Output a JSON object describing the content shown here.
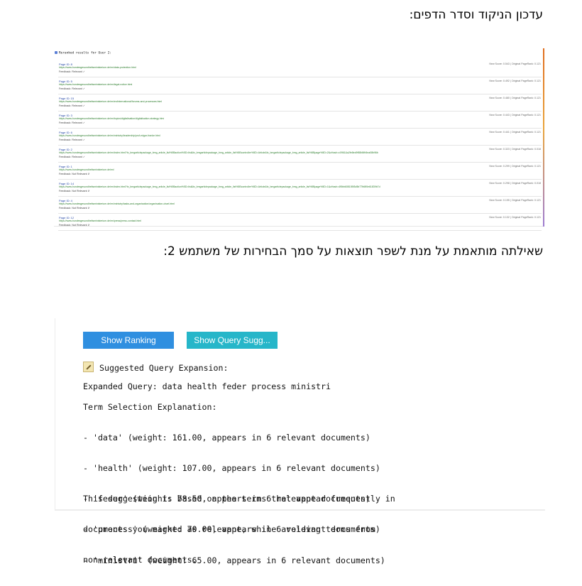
{
  "headings": {
    "top": "עדכון הניקוד וסדר הדפים:",
    "middle": "שאילתה מותאמת על מנת לשפר תוצאות על סמך הבחירות של משתמש 2:"
  },
  "rerank": {
    "title": "Reranked results for User 2:",
    "results": [
      {
        "page": "Page ID: 8",
        "url": "https://www.bundesgesundheitsministerium.de/en/data-protection.html",
        "feedback": "Feedback: Relevant ✓",
        "score": "New Score: 0.543 | Original PageRank: 0.121"
      },
      {
        "page": "Page ID: 5",
        "url": "https://www.bundesgesundheitsministerium.de/en/legal-notice.html",
        "feedback": "Feedback: Relevant ✓",
        "score": "New Score: 0.492 | Original PageRank: 0.121"
      },
      {
        "page": "Page ID: 15",
        "url": "https://www.bundesgesundheitsministerium.de/en/en/international/forums-and-processes.html",
        "feedback": "Feedback: Relevant ✓",
        "score": "New Score: 0.480 | Original PageRank: 0.121"
      },
      {
        "page": "Page ID: 3",
        "url": "https://www.bundesgesundheitsministerium.de/en/topics/digitalisation/digitalisation-strategy.html",
        "feedback": "Feedback: Relevant ✓",
        "score": "New Score: 0.443 | Original PageRank: 0.121"
      },
      {
        "page": "Page ID: 6",
        "url": "https://www.bundesgesundheitsministerium.de/en/ministry/leadership/prof-edgar-franke.html",
        "feedback": "Feedback: Relevant ✓",
        "score": "New Score: 0.441 | Original PageRank: 0.121"
      },
      {
        "page": "Page ID: 2",
        "url": "https://www.bundesgesundheitsministerium.de/en/index.html?tx_bmgarticlepackage_bmg_article_list%5Baction%5D=list&tx_bmgarticlepackage_bmg_article_list%5Bcontroller%5D=Article&tx_bmgarticlepackage_bmg_article_list%5Bpage%5D=2&cHash=c0961&a2fe8ed9f65b5fb5ea08b96b",
        "feedback": "Feedback: Relevant ✓",
        "score": "New Score: 0.323 | Original PageRank: 0.018"
      },
      {
        "page": "Page ID: 1",
        "url": "https://www.bundesgesundheitsministerium.de/en/",
        "feedback": "Feedback: Not Relevant ✗",
        "score": "New Score: 0.299 | Original PageRank: 0.121"
      },
      {
        "page": "Page ID: 14",
        "url": "https://www.bundesgesundheitsministerium.de/en/index.html?tx_bmgarticlepackage_bmg_article_list%5Baction%5D=list&tx_bmgarticlepackage_bmg_article_list%5Bcontroller%5D=Article&tx_bmgarticlepackage_bmg_article_list%5Bpage%5D=1&cHash=4f5bb608155f3d5b77fb8f0e61839b7d",
        "feedback": "Feedback: Not Relevant ✗",
        "score": "New Score: 0.298 | Original PageRank: 0.018"
      },
      {
        "page": "Page ID: 4",
        "url": "https://www.bundesgesundheitsministerium.de/en/ministry/tasks-and-organisation/organisation-chart.html",
        "feedback": "Feedback: Not Relevant ✗",
        "score": "New Score: 0.195 | Original PageRank: 0.121"
      },
      {
        "page": "Page ID: 12",
        "url": "https://www.bundesgesundheitsministerium.de/en/press/press-contact.html",
        "feedback": "Feedback: Not Relevant ✗",
        "score": "New Score: 0.132 | Original PageRank: 0.121"
      }
    ]
  },
  "buttons": {
    "show_ranking": "Show Ranking",
    "show_query": "Show Query Sugg..."
  },
  "suggestion": {
    "title": "Suggested Query Expansion:",
    "expanded": "Expanded Query: data health feder process ministri",
    "explanation_title": "Term Selection Explanation:",
    "terms": [
      "- 'data' (weight: 161.00, appears in 6 relevant documents)",
      "- 'health' (weight: 107.00, appears in 6 relevant documents)",
      "- 'feder' (weight: 78.50, appears in 6 relevant documents)",
      "- 'process' (weight: 70.00, appears in 6 relevant documents)",
      "- 'ministri' (weight: 65.00, appears in 6 relevant documents)"
    ],
    "note": [
      "This suggestion is based on the terms that appear frequently in",
      "documents you marked as relevant, while avoiding terms from",
      "non-relevant documents."
    ]
  }
}
